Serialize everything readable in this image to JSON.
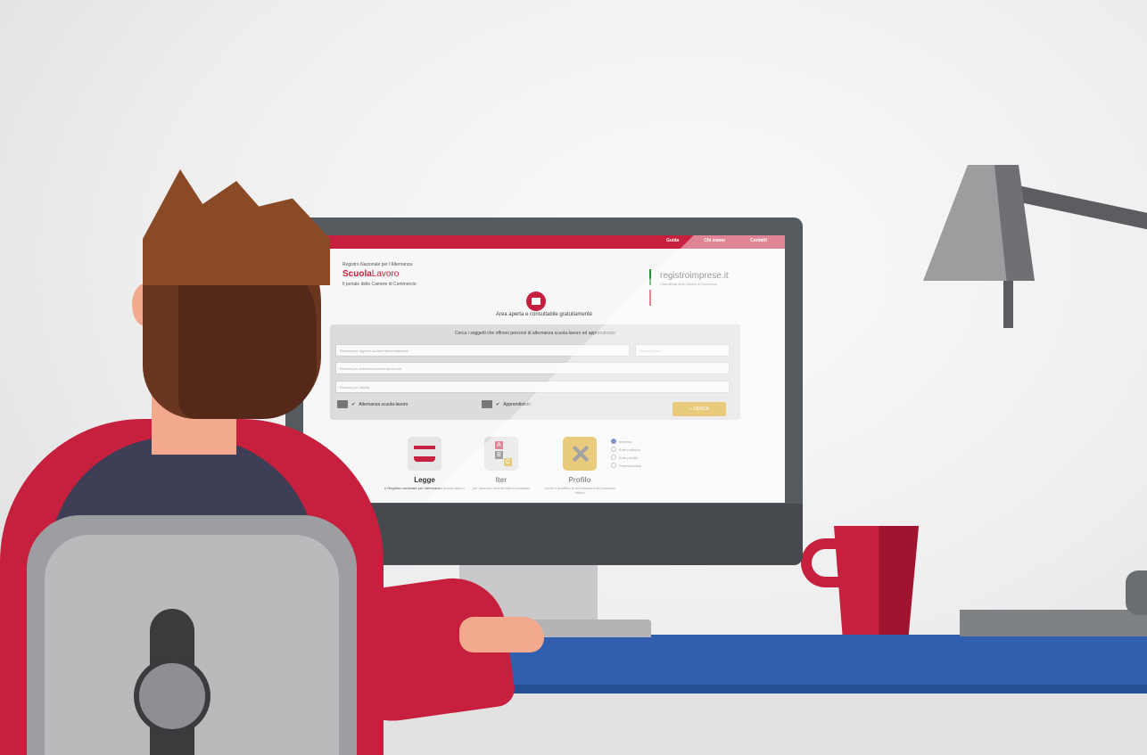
{
  "screen": {
    "topnav": [
      "Guida",
      "Chi siamo",
      "Contatti"
    ],
    "logo_left": {
      "line1": "Registro Nazionale per l'Alternanza",
      "brand_bold": "Scuola",
      "brand_light": "Lavoro",
      "line3": "Il portale delle Camere di Commercio"
    },
    "logo_right": {
      "brand": "registroimprese.it",
      "tagline": "I dati ufficiali delle Camere di Commercio"
    },
    "area_title": "Area aperta e consultabile gratuitamente",
    "search": {
      "headline": "Cerca i soggetti che offrono percorsi di alternanza scuola-lavoro ed apprendistato",
      "field1_placeholder": "Ricerca per ragione sociale/denominazione",
      "field1b_placeholder": "Settore/Area",
      "field2_placeholder": "Ricerca per indirizzo/comune/provincia",
      "field3_placeholder": "Ricerca per attività",
      "option1": "Alternanza scuola-lavoro",
      "option2": "Apprendistato",
      "search_button": "CERCA"
    },
    "tiles": [
      {
        "label": "Legge",
        "desc": "Il Registro nazionale per l'alternanza scuola-lavoro"
      },
      {
        "label": "Iter",
        "desc": "per imprese, enti ed istituti scolastici"
      },
      {
        "label": "Profilo",
        "desc": "Iscrivi e modifica le informazioni del percorso offerto"
      }
    ],
    "radios": [
      "Impresa",
      "Ente pubblico",
      "Ente privato",
      "Professionista"
    ]
  },
  "colors": {
    "brand_red": "#c6203e",
    "gold": "#d6a012",
    "desk_blue": "#2f5fae"
  }
}
